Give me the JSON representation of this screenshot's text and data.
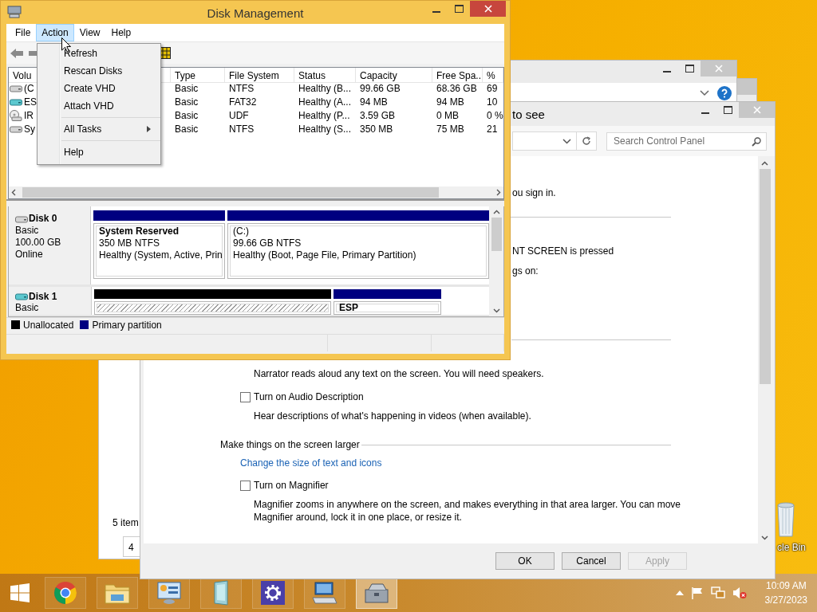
{
  "desktop": {
    "recycle_bin": {
      "label": "cle Bin"
    }
  },
  "explorer_window": {
    "status": "5 item",
    "field": "4"
  },
  "control_panel": {
    "title": "to see",
    "search": {
      "placeholder": "Search Control Panel"
    },
    "content": [
      {
        "kind": "fragment",
        "text": "ou sign in."
      },
      {
        "kind": "rule"
      },
      {
        "kind": "fragment",
        "text": "NT SCREEN is pressed"
      },
      {
        "kind": "fragment",
        "text": "gs on:"
      },
      {
        "kind": "rule"
      },
      {
        "kind": "description",
        "text": "Narrator reads aloud any text on the screen. You will need speakers."
      },
      {
        "kind": "checkbox",
        "label": "Turn on Audio Description",
        "checked": false
      },
      {
        "kind": "description",
        "text": "Hear descriptions of what's happening in videos (when available)."
      },
      {
        "kind": "heading",
        "text": "Make things on the screen larger"
      },
      {
        "kind": "link",
        "text": "Change the size of text and icons"
      },
      {
        "kind": "checkbox",
        "label": "Turn on Magnifier",
        "checked": false
      },
      {
        "kind": "description",
        "text": "Magnifier zooms in anywhere on the screen, and makes everything in that area larger. You can move Magnifier around, lock it in one place, or resize it."
      }
    ],
    "buttons": [
      {
        "label": "OK",
        "disabled": false
      },
      {
        "label": "Cancel",
        "disabled": false
      },
      {
        "label": "Apply",
        "disabled": true
      }
    ]
  },
  "disk_management": {
    "title": "Disk Management",
    "menus": [
      {
        "label": "File",
        "selected": false
      },
      {
        "label": "Action",
        "selected": true
      },
      {
        "label": "View",
        "selected": false
      },
      {
        "label": "Help",
        "selected": false
      }
    ],
    "action_menu": [
      {
        "kind": "item",
        "label": "Refresh"
      },
      {
        "kind": "item",
        "label": "Rescan Disks"
      },
      {
        "kind": "item",
        "label": "Create VHD"
      },
      {
        "kind": "item",
        "label": "Attach VHD"
      },
      {
        "kind": "separator"
      },
      {
        "kind": "submenu",
        "label": "All Tasks"
      },
      {
        "kind": "separator"
      },
      {
        "kind": "item",
        "label": "Help"
      }
    ],
    "volume_list": {
      "columns": [
        "Volu",
        "Type",
        "File System",
        "Status",
        "Capacity",
        "Free Spa...",
        "%"
      ],
      "rows": [
        {
          "kind": "hdd",
          "cells": [
            "(C",
            "Basic",
            "NTFS",
            "Healthy (B...",
            "99.66 GB",
            "68.36 GB",
            "69"
          ]
        },
        {
          "kind": "usb",
          "cells": [
            "ES",
            "Basic",
            "FAT32",
            "Healthy (A...",
            "94 MB",
            "94 MB",
            "10"
          ]
        },
        {
          "kind": "optical",
          "cells": [
            "IR",
            "Basic",
            "UDF",
            "Healthy (P...",
            "3.59 GB",
            "0 MB",
            "0 %"
          ]
        },
        {
          "kind": "hdd",
          "cells": [
            "Sy",
            "Basic",
            "NTFS",
            "Healthy (S...",
            "350 MB",
            "75 MB",
            "21"
          ]
        }
      ]
    },
    "disks": [
      {
        "kind": "hdd",
        "name": "Disk 0",
        "type": "Basic",
        "size": "100.00 GB",
        "status": "Online",
        "partitions": [
          {
            "kind": "primary",
            "name": "System Reserved",
            "bold": true,
            "detail": "350 MB NTFS",
            "status": "Healthy (System, Active, Prin"
          },
          {
            "kind": "primary",
            "name": "(C:)",
            "bold": false,
            "detail": "99.66 GB NTFS",
            "status": "Healthy (Boot, Page File, Primary Partition)"
          }
        ]
      },
      {
        "kind": "usb",
        "name": "Disk 1",
        "type": "Basic",
        "partitions": [
          {
            "kind": "unallocated"
          },
          {
            "kind": "primary",
            "name": "ESP",
            "bold": true
          }
        ]
      }
    ],
    "legend": [
      {
        "label": "Unallocated",
        "color": "#000000"
      },
      {
        "label": "Primary partition",
        "color": "#000080"
      }
    ]
  },
  "taskbar": {
    "apps": [
      {
        "kind": "chrome",
        "selected": false
      },
      {
        "kind": "explorer",
        "selected": false
      },
      {
        "kind": "control-panel",
        "selected": false
      },
      {
        "kind": "tablet",
        "selected": false
      },
      {
        "kind": "settings",
        "selected": false
      },
      {
        "kind": "computer",
        "selected": false
      },
      {
        "kind": "disk-management",
        "selected": true
      }
    ],
    "clock": {
      "time": "10:09 AM",
      "date": "3/27/2023"
    }
  }
}
